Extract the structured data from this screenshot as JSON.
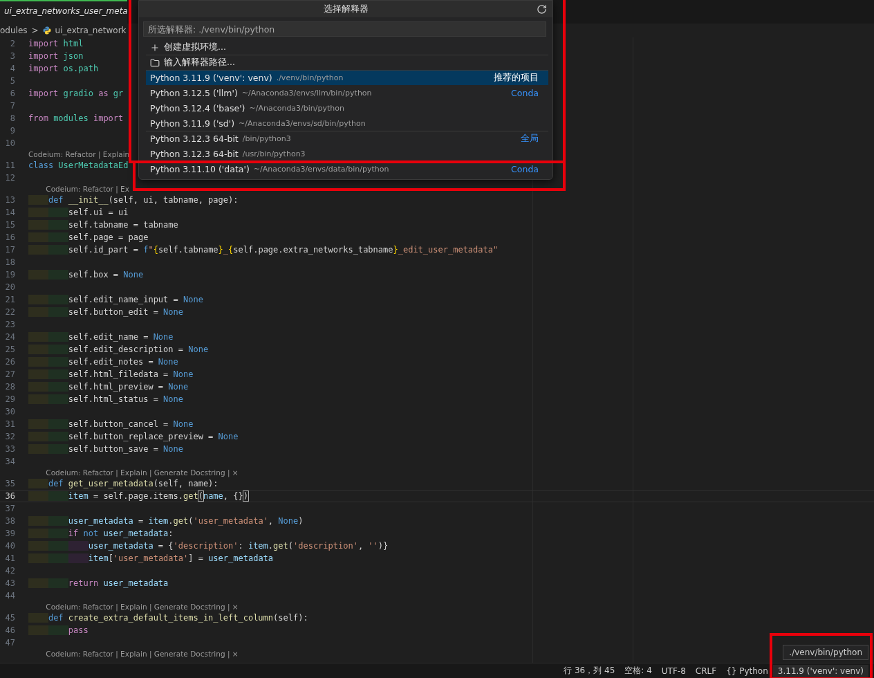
{
  "editor_tab": {
    "title": "ui_extra_networks_user_meta",
    "active": true
  },
  "breadcrumb": {
    "items": [
      "odules",
      "ui_extra_network"
    ],
    "separator": ">"
  },
  "editor_rows": [
    {
      "kind": "code",
      "number": "2",
      "tokens": [
        {
          "kind": "kw",
          "text": "import"
        },
        {
          "kind": "mod",
          "text": " html"
        }
      ]
    },
    {
      "kind": "code",
      "number": "3",
      "tokens": [
        {
          "kind": "kw",
          "text": "import"
        },
        {
          "kind": "mod",
          "text": " json"
        }
      ]
    },
    {
      "kind": "code",
      "number": "4",
      "tokens": [
        {
          "kind": "kw",
          "text": "import"
        },
        {
          "kind": "mod",
          "text": " os.path"
        }
      ]
    },
    {
      "kind": "code",
      "number": "5",
      "tokens": []
    },
    {
      "kind": "code",
      "number": "6",
      "tokens": [
        {
          "kind": "kw",
          "text": "import"
        },
        {
          "kind": "mod",
          "text": " gradio"
        },
        {
          "kind": "kw",
          "text": " as"
        },
        {
          "kind": "mod",
          "text": " gr"
        }
      ]
    },
    {
      "kind": "code",
      "number": "7",
      "tokens": []
    },
    {
      "kind": "code",
      "number": "8",
      "tokens": [
        {
          "kind": "kw",
          "text": "from"
        },
        {
          "kind": "mod",
          "text": " modules"
        },
        {
          "kind": "kw",
          "text": " import"
        }
      ]
    },
    {
      "kind": "code",
      "number": "9",
      "tokens": []
    },
    {
      "kind": "code",
      "number": "10",
      "tokens": []
    },
    {
      "kind": "lens",
      "text": "Codeium: Refactor | Explain"
    },
    {
      "kind": "code",
      "number": "11",
      "tokens": [
        {
          "kind": "def",
          "text": "class"
        },
        {
          "kind": "mod",
          "text": " UserMetadataEd"
        }
      ]
    },
    {
      "kind": "code",
      "number": "12",
      "tokens": []
    },
    {
      "kind": "lens",
      "text": "    Codeium: Refactor | Ex"
    },
    {
      "kind": "code",
      "number": "13",
      "tokens": [
        {
          "kind": "def",
          "text": "    def"
        },
        {
          "kind": "fn",
          "text": " __init__"
        },
        {
          "kind": "txt",
          "text": "(self, ui, tabname, page):"
        }
      ]
    },
    {
      "kind": "code",
      "number": "14",
      "tokens": [
        {
          "kind": "txt",
          "text": "        self.ui = ui"
        }
      ]
    },
    {
      "kind": "code",
      "number": "15",
      "tokens": [
        {
          "kind": "txt",
          "text": "        self.tabname = tabname"
        }
      ]
    },
    {
      "kind": "code",
      "number": "16",
      "tokens": [
        {
          "kind": "txt",
          "text": "        self.page = page"
        }
      ]
    },
    {
      "kind": "code",
      "number": "17",
      "tokens": [
        {
          "kind": "txt",
          "text": "        self.id_part = "
        },
        {
          "kind": "def",
          "text": "f"
        },
        {
          "kind": "str",
          "text": "\""
        },
        {
          "kind": "brace",
          "text": "{"
        },
        {
          "kind": "txt",
          "text": "self.tabname"
        },
        {
          "kind": "brace",
          "text": "}"
        },
        {
          "kind": "str",
          "text": "_"
        },
        {
          "kind": "brace",
          "text": "{"
        },
        {
          "kind": "txt",
          "text": "self.page.extra_networks_tabname"
        },
        {
          "kind": "brace",
          "text": "}"
        },
        {
          "kind": "str",
          "text": "_edit_user_metadata\""
        }
      ]
    },
    {
      "kind": "code",
      "number": "18",
      "tokens": []
    },
    {
      "kind": "code",
      "number": "19",
      "tokens": [
        {
          "kind": "txt",
          "text": "        self.box = "
        },
        {
          "kind": "def",
          "text": "None"
        }
      ]
    },
    {
      "kind": "code",
      "number": "20",
      "tokens": []
    },
    {
      "kind": "code",
      "number": "21",
      "tokens": [
        {
          "kind": "txt",
          "text": "        self.edit_name_input = "
        },
        {
          "kind": "def",
          "text": "None"
        }
      ]
    },
    {
      "kind": "code",
      "number": "22",
      "tokens": [
        {
          "kind": "txt",
          "text": "        self.button_edit = "
        },
        {
          "kind": "def",
          "text": "None"
        }
      ]
    },
    {
      "kind": "code",
      "number": "23",
      "tokens": []
    },
    {
      "kind": "code",
      "number": "24",
      "tokens": [
        {
          "kind": "txt",
          "text": "        self.edit_name = "
        },
        {
          "kind": "def",
          "text": "None"
        }
      ]
    },
    {
      "kind": "code",
      "number": "25",
      "tokens": [
        {
          "kind": "txt",
          "text": "        self.edit_description = "
        },
        {
          "kind": "def",
          "text": "None"
        }
      ]
    },
    {
      "kind": "code",
      "number": "26",
      "tokens": [
        {
          "kind": "txt",
          "text": "        self.edit_notes = "
        },
        {
          "kind": "def",
          "text": "None"
        }
      ]
    },
    {
      "kind": "code",
      "number": "27",
      "tokens": [
        {
          "kind": "txt",
          "text": "        self.html_filedata = "
        },
        {
          "kind": "def",
          "text": "None"
        }
      ]
    },
    {
      "kind": "code",
      "number": "28",
      "tokens": [
        {
          "kind": "txt",
          "text": "        self.html_preview = "
        },
        {
          "kind": "def",
          "text": "None"
        }
      ]
    },
    {
      "kind": "code",
      "number": "29",
      "tokens": [
        {
          "kind": "txt",
          "text": "        self.html_status = "
        },
        {
          "kind": "def",
          "text": "None"
        }
      ]
    },
    {
      "kind": "code",
      "number": "30",
      "tokens": []
    },
    {
      "kind": "code",
      "number": "31",
      "tokens": [
        {
          "kind": "txt",
          "text": "        self.button_cancel = "
        },
        {
          "kind": "def",
          "text": "None"
        }
      ]
    },
    {
      "kind": "code",
      "number": "32",
      "tokens": [
        {
          "kind": "txt",
          "text": "        self.button_replace_preview = "
        },
        {
          "kind": "def",
          "text": "None"
        }
      ]
    },
    {
      "kind": "code",
      "number": "33",
      "tokens": [
        {
          "kind": "txt",
          "text": "        self.button_save = "
        },
        {
          "kind": "def",
          "text": "None"
        }
      ]
    },
    {
      "kind": "code",
      "number": "34",
      "tokens": []
    },
    {
      "kind": "lens",
      "text": "    Codeium: Refactor | Explain | Generate Docstring | ×"
    },
    {
      "kind": "code",
      "number": "35",
      "tokens": [
        {
          "kind": "def",
          "text": "    def"
        },
        {
          "kind": "fn",
          "text": " get_user_metadata"
        },
        {
          "kind": "txt",
          "text": "(self, name):"
        }
      ]
    },
    {
      "kind": "code",
      "number": "36",
      "current": true,
      "tokens": [
        {
          "kind": "var",
          "text": "        item"
        },
        {
          "kind": "txt",
          "text": " = self.page.items."
        },
        {
          "kind": "fn",
          "text": "get"
        },
        {
          "kind": "match",
          "text": "("
        },
        {
          "kind": "var",
          "text": "name"
        },
        {
          "kind": "txt",
          "text": ", {}"
        },
        {
          "kind": "match",
          "text": ")"
        }
      ]
    },
    {
      "kind": "code",
      "number": "37",
      "tokens": []
    },
    {
      "kind": "code",
      "number": "38",
      "tokens": [
        {
          "kind": "var",
          "text": "        user_metadata"
        },
        {
          "kind": "txt",
          "text": " = "
        },
        {
          "kind": "var",
          "text": "item"
        },
        {
          "kind": "txt",
          "text": "."
        },
        {
          "kind": "fn",
          "text": "get"
        },
        {
          "kind": "txt",
          "text": "("
        },
        {
          "kind": "str",
          "text": "'user_metadata'"
        },
        {
          "kind": "txt",
          "text": ", "
        },
        {
          "kind": "def",
          "text": "None"
        },
        {
          "kind": "txt",
          "text": ")"
        }
      ]
    },
    {
      "kind": "code",
      "number": "39",
      "tokens": [
        {
          "kind": "kw",
          "text": "        if"
        },
        {
          "kind": "def",
          "text": " not"
        },
        {
          "kind": "var",
          "text": " user_metadata"
        },
        {
          "kind": "txt",
          "text": ":"
        }
      ]
    },
    {
      "kind": "code",
      "number": "40",
      "tokens": [
        {
          "kind": "var",
          "text": "            user_metadata"
        },
        {
          "kind": "txt",
          "text": " = {"
        },
        {
          "kind": "str",
          "text": "'description'"
        },
        {
          "kind": "txt",
          "text": ": "
        },
        {
          "kind": "var",
          "text": "item"
        },
        {
          "kind": "txt",
          "text": "."
        },
        {
          "kind": "fn",
          "text": "get"
        },
        {
          "kind": "txt",
          "text": "("
        },
        {
          "kind": "str",
          "text": "'description'"
        },
        {
          "kind": "txt",
          "text": ", "
        },
        {
          "kind": "str",
          "text": "''"
        },
        {
          "kind": "txt",
          "text": ")}"
        }
      ]
    },
    {
      "kind": "code",
      "number": "41",
      "tokens": [
        {
          "kind": "var",
          "text": "            item"
        },
        {
          "kind": "txt",
          "text": "["
        },
        {
          "kind": "str",
          "text": "'user_metadata'"
        },
        {
          "kind": "txt",
          "text": "] = "
        },
        {
          "kind": "var",
          "text": "user_metadata"
        }
      ]
    },
    {
      "kind": "code",
      "number": "42",
      "tokens": []
    },
    {
      "kind": "code",
      "number": "43",
      "tokens": [
        {
          "kind": "kw",
          "text": "        return"
        },
        {
          "kind": "var",
          "text": " user_metadata"
        }
      ]
    },
    {
      "kind": "code",
      "number": "44",
      "tokens": []
    },
    {
      "kind": "lens",
      "text": "    Codeium: Refactor | Explain | Generate Docstring | ×"
    },
    {
      "kind": "code",
      "number": "45",
      "tokens": [
        {
          "kind": "def",
          "text": "    def"
        },
        {
          "kind": "fn",
          "text": " create_extra_default_items_in_left_column"
        },
        {
          "kind": "txt",
          "text": "(self):"
        }
      ]
    },
    {
      "kind": "code",
      "number": "46",
      "tokens": [
        {
          "kind": "kw",
          "text": "        pass"
        }
      ]
    },
    {
      "kind": "code",
      "number": "47",
      "tokens": []
    },
    {
      "kind": "lens",
      "text": "    Codeium: Refactor | Explain | Generate Docstring | ×"
    }
  ],
  "interpreter_picker": {
    "title": "选择解释器",
    "placeholder": "所选解释器: ./venv/bin/python",
    "items": [
      {
        "kind": "create",
        "label": "创建虚拟环境...",
        "selected": false,
        "separator_before": false
      },
      {
        "kind": "browse",
        "label": "输入解释器路径...",
        "selected": false,
        "separator_before": true
      },
      {
        "kind": "interpreter",
        "label": "Python 3.11.9 ('venv': venv)",
        "description": "./venv/bin/python",
        "badge": "推荐的项目",
        "selected": true,
        "separator_before": true
      },
      {
        "kind": "interpreter",
        "label": "Python 3.12.5 ('llm')",
        "description": "~/Anaconda3/envs/llm/bin/python",
        "badge": "Conda",
        "selected": false,
        "separator_before": false
      },
      {
        "kind": "interpreter",
        "label": "Python 3.12.4 ('base')",
        "description": "~/Anaconda3/bin/python",
        "selected": false,
        "separator_before": false
      },
      {
        "kind": "interpreter",
        "label": "Python 3.11.9 ('sd')",
        "description": "~/Anaconda3/envs/sd/bin/python",
        "selected": false,
        "separator_before": false
      },
      {
        "kind": "interpreter",
        "label": "Python 3.12.3 64-bit",
        "description": "/bin/python3",
        "badge": "全局",
        "selected": false,
        "separator_before": true
      },
      {
        "kind": "interpreter",
        "label": "Python 3.12.3 64-bit",
        "description": "/usr/bin/python3",
        "selected": false,
        "separator_before": false
      },
      {
        "kind": "interpreter",
        "label": "Python 3.11.10 ('data')",
        "description": "~/Anaconda3/envs/data/bin/python",
        "badge": "Conda",
        "selected": false
      }
    ]
  },
  "tooltip": {
    "text": "./venv/bin/python"
  },
  "status_bar": [
    {
      "kind": "text",
      "label": "行 36，列 45"
    },
    {
      "kind": "text",
      "label": "空格: 4"
    },
    {
      "kind": "text",
      "label": "UTF-8"
    },
    {
      "kind": "text",
      "label": "CRLF"
    },
    {
      "kind": "language",
      "label": "{} Python"
    },
    {
      "kind": "interpreter",
      "label": "3.11.9 ('venv': venv)"
    }
  ],
  "highlight_frames": [
    {
      "kind": "picker"
    },
    {
      "kind": "picker_last_item"
    },
    {
      "kind": "status_interpreter"
    }
  ]
}
